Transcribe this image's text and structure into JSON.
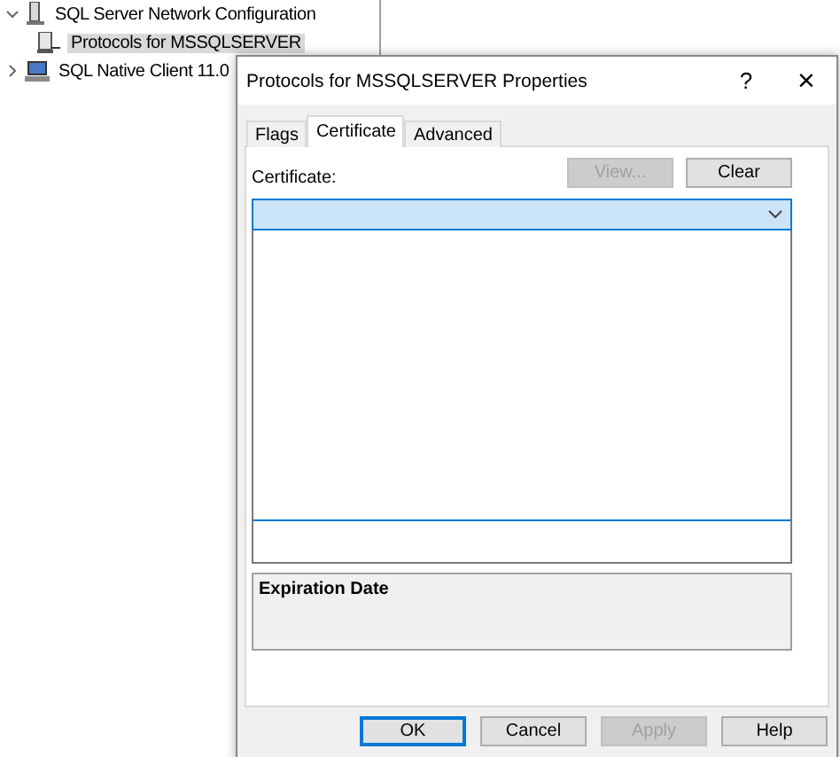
{
  "tree": {
    "items": [
      {
        "label": "SQL Server Network Configuration",
        "expanded": true,
        "selected": false,
        "children": [
          {
            "label": "Protocols for MSSQLSERVER",
            "selected": true
          }
        ]
      },
      {
        "label": "SQL Native Client 11.0",
        "expanded": false,
        "selected": false
      }
    ]
  },
  "dialog": {
    "title": "Protocols for MSSQLSERVER Properties",
    "help": "?",
    "close": "×",
    "tabs": [
      {
        "label": "Flags",
        "selected": false
      },
      {
        "label": "Certificate",
        "selected": true
      },
      {
        "label": "Advanced",
        "selected": false
      }
    ],
    "certificate_label": "Certificate:",
    "view_button": {
      "label": "View...",
      "disabled": true
    },
    "clear_button": {
      "label": "Clear",
      "disabled": false
    },
    "expiration_label": "Expiration Date",
    "buttons": [
      {
        "label": "OK",
        "disabled": false,
        "default": true
      },
      {
        "label": "Cancel",
        "disabled": false,
        "default": false
      },
      {
        "label": "Apply",
        "disabled": true,
        "default": false
      },
      {
        "label": "Help",
        "disabled": false,
        "default": false
      }
    ]
  }
}
